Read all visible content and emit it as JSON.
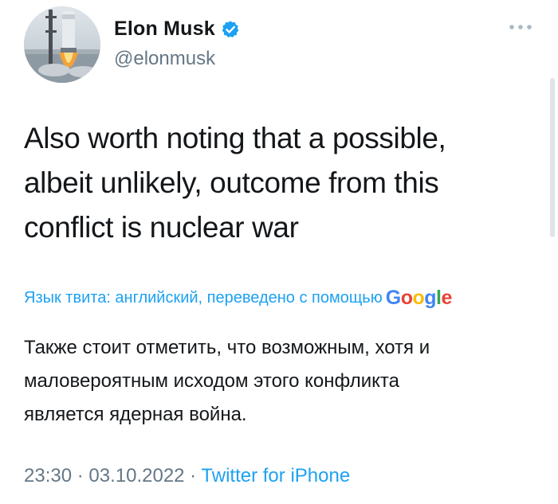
{
  "author": {
    "name": "Elon Musk",
    "handle": "@elonmusk"
  },
  "tweet": {
    "text_lines": [
      "Also worth noting that a possible,",
      "albeit unlikely, outcome from this",
      "conflict is nuclear war"
    ]
  },
  "translation": {
    "info": "Язык твита: английский, переведено с помощью",
    "provider": [
      "G",
      "o",
      "o",
      "g",
      "l",
      "e"
    ],
    "lines": [
      "Также стоит отметить, что возможным, хотя и",
      "маловероятным исходом этого конфликта",
      "является ядерная война."
    ]
  },
  "meta": {
    "time": "23:30",
    "separator": " · ",
    "date": "03.10.2022",
    "source": "Twitter for iPhone"
  },
  "colors": {
    "link": "#1da1f2",
    "secondary": "#657786",
    "verified": "#1da1f2"
  },
  "icons": {
    "verified": "verified-badge-icon",
    "more": "more-options-icon"
  }
}
